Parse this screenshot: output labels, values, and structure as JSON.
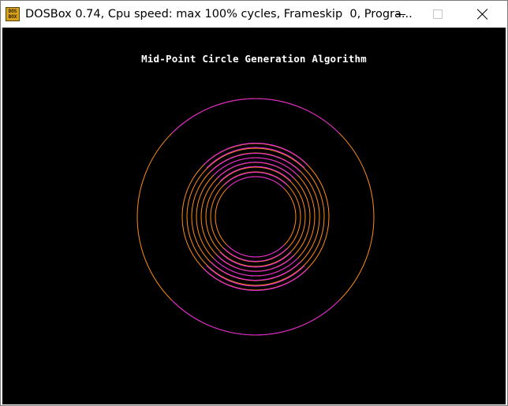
{
  "window": {
    "title": "DOSBox 0.74, Cpu speed: max 100% cycles, Frameskip  0, Progra...",
    "icon_text": "DOS BOX"
  },
  "screen": {
    "heading": "Mid-Point Circle Generation Algorithm"
  },
  "colors": {
    "orange": "#ff8c1a",
    "magenta": "#e020e0",
    "outer_ring_top": "magenta",
    "outer_ring_sides": "orange"
  }
}
